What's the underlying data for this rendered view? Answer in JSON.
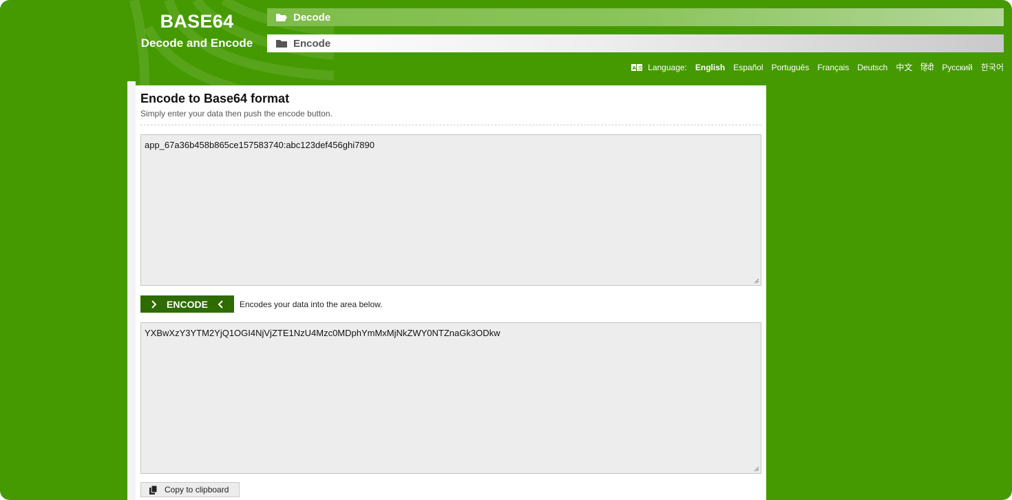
{
  "logo": {
    "title": "BASE64",
    "subtitle": "Decode and Encode"
  },
  "tabs": {
    "decode": {
      "label": "Decode",
      "icon": "folder-open-icon"
    },
    "encode": {
      "label": "Encode",
      "icon": "folder-icon"
    }
  },
  "language": {
    "label": "Language:",
    "icon": "translate-icon",
    "options": [
      "English",
      "Español",
      "Português",
      "Français",
      "Deutsch",
      "中文",
      "हिंदी",
      "Русский",
      "한국어"
    ],
    "selected": "English"
  },
  "panel": {
    "title": "Encode to Base64 format",
    "subtitle": "Simply enter your data then push the encode button."
  },
  "input": {
    "value": "app_67a36b458b865ce157583740:abc123def456ghi7890"
  },
  "encode_button": {
    "label": "ENCODE",
    "hint": "Encodes your data into the area below."
  },
  "output": {
    "value": "YXBwXzY3YTM2YjQ1OGI4NjVjZTE1NzU4Mzc0MDphYmMxMjNkZWY0NTZnaGk3ODkw"
  },
  "copy_button": {
    "label": "Copy to clipboard",
    "icon": "copy-icon"
  },
  "colors": {
    "background": "#449a00",
    "button": "#2e6b00",
    "textarea": "#ededed"
  }
}
